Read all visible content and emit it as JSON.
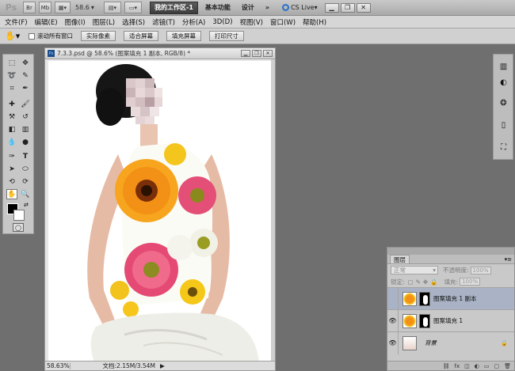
{
  "app": {
    "logo": "Ps",
    "mb_label": "Mb",
    "zoom_value": "58.6",
    "workspaces": {
      "active": "我的工作区-1",
      "basic": "基本功能",
      "design": "设计",
      "more": "»"
    },
    "cs_live": "CS Live"
  },
  "menu": {
    "items": [
      "文件(F)",
      "编辑(E)",
      "图像(I)",
      "图层(L)",
      "选择(S)",
      "滤镜(T)",
      "分析(A)",
      "3D(D)",
      "视图(V)",
      "窗口(W)",
      "帮助(H)"
    ]
  },
  "options": {
    "scroll_all": "滚动所有窗口",
    "actual_pixels": "实际像素",
    "fit_screen": "适合屏幕",
    "fill_screen": "填充屏幕",
    "print_size": "打印尺寸"
  },
  "document": {
    "tab_title": "7.3.3.psd @ 58.6% (图案填充 1 副本, RGB/8) *",
    "status_zoom": "58.63%",
    "status_doc": "文档:2.15M/3.54M"
  },
  "layers": {
    "tab": "图层",
    "blend_mode": "正常",
    "opacity_label": "不透明度:",
    "opacity_value": "100%",
    "lock_label": "锁定:",
    "fill_label": "填充:",
    "fill_value": "100%",
    "rows": [
      {
        "name": "图案填充 1 副本"
      },
      {
        "name": "图案填充 1"
      },
      {
        "name": "背景"
      }
    ]
  },
  "colors": {
    "active_workspace": "#3c3c3c",
    "selected_layer": "#a9b3c5"
  }
}
